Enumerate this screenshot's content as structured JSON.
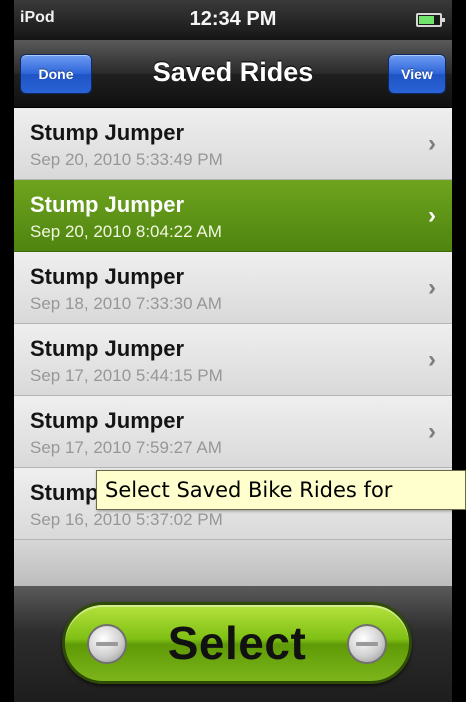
{
  "status_bar": {
    "carrier": "iPod",
    "time": "12:34 PM",
    "battery_icon": "battery-icon"
  },
  "nav": {
    "title": "Saved Rides",
    "left_button": "Done",
    "right_button": "View"
  },
  "rides": [
    {
      "name": "Stump Jumper",
      "date": "Sep 20, 2010 5:33:49 PM",
      "selected": false
    },
    {
      "name": "Stump Jumper",
      "date": "Sep 20, 2010 8:04:22 AM",
      "selected": true
    },
    {
      "name": "Stump Jumper",
      "date": "Sep 18, 2010 7:33:30 AM",
      "selected": false
    },
    {
      "name": "Stump Jumper",
      "date": "Sep 17, 2010 5:44:15 PM",
      "selected": false
    },
    {
      "name": "Stump Jumper",
      "date": "Sep 17, 2010 7:59:27 AM",
      "selected": false
    },
    {
      "name": "Stump Jumper",
      "date": "Sep 16, 2010 5:37:02 PM",
      "selected": false
    }
  ],
  "chevron_glyph": "›",
  "tooltip": "Select Saved Bike Rides for",
  "select_button": "Select",
  "colors": {
    "selected_row": "#5f9416",
    "nav_button": "#2c63d8",
    "select_button": "#7fbf14",
    "tooltip_bg": "#ffffcd"
  }
}
